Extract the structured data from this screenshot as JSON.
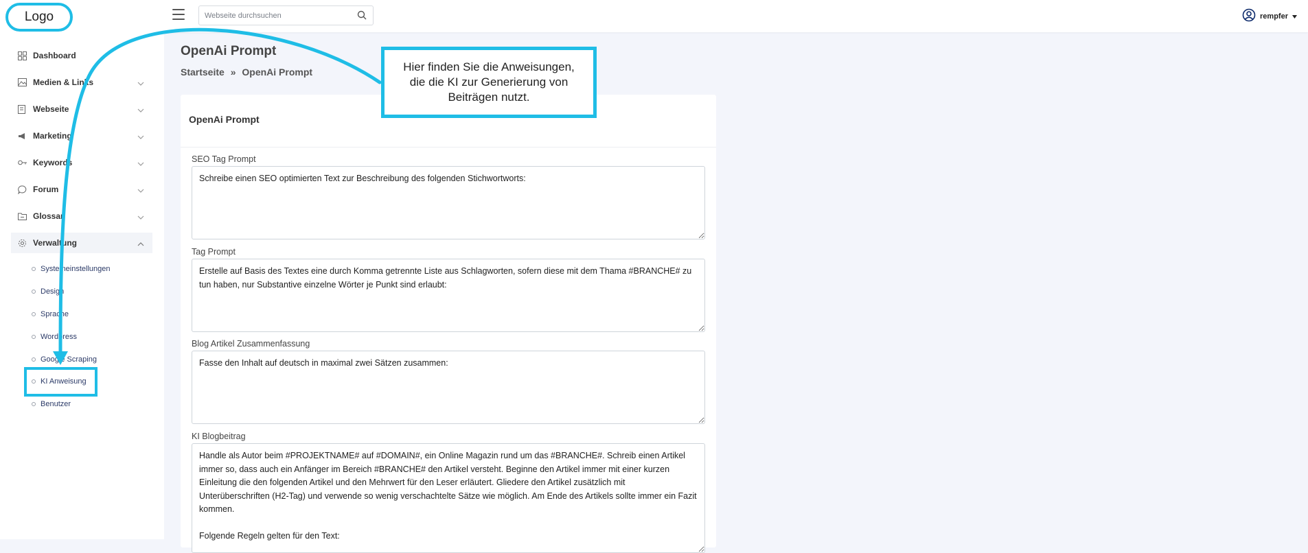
{
  "header": {
    "logo_text": "Logo",
    "search_placeholder": "Webseite durchsuchen",
    "username": "rempfer"
  },
  "sidebar": {
    "items": [
      {
        "label": "Dashboard",
        "icon": "grid-icon"
      },
      {
        "label": "Medien & Links",
        "icon": "image-icon"
      },
      {
        "label": "Webseite",
        "icon": "file-icon"
      },
      {
        "label": "Marketing",
        "icon": "megaphone-icon"
      },
      {
        "label": "Keywords",
        "icon": "key-icon"
      },
      {
        "label": "Forum",
        "icon": "chat-icon"
      },
      {
        "label": "Glossar",
        "icon": "folder-icon"
      },
      {
        "label": "Verwaltung",
        "icon": "gear-icon"
      }
    ],
    "subitems": [
      "Systemeinstellungen",
      "Design",
      "Sprache",
      "Wordpress",
      "Google Scraping",
      "KI Anweisung",
      "Benutzer"
    ]
  },
  "page": {
    "title": "OpenAi Prompt",
    "breadcrumb_home": "Startseite",
    "breadcrumb_sep": "»",
    "breadcrumb_current": "OpenAi Prompt"
  },
  "card": {
    "title": "OpenAi Prompt",
    "fields": [
      {
        "label": "SEO Tag Prompt",
        "value": "Schreibe einen SEO optimierten Text zur Beschreibung des folgenden Stichwortworts:"
      },
      {
        "label": "Tag Prompt",
        "value": "Erstelle auf Basis des Textes eine durch Komma getrennte Liste aus Schlagworten, sofern diese mit dem Thama #BRANCHE# zu tun haben, nur Substantive einzelne Wörter je Punkt sind erlaubt:"
      },
      {
        "label": "Blog Artikel Zusammenfassung",
        "value": "Fasse den Inhalt auf deutsch in maximal zwei Sätzen zusammen:"
      },
      {
        "label": "KI Blogbeitrag",
        "value": "Handle als Autor beim #PROJEKTNAME# auf #DOMAIN#, ein Online Magazin rund um das #BRANCHE#. Schreib einen Artikel immer so, dass auch ein Anfänger im Bereich #BRANCHE# den Artikel versteht. Beginne den Artikel immer mit einer kurzen Einleitung die den folgenden Artikel und den Mehrwert für den Leser erläutert. Gliedere den Artikel zusätzlich mit Unterüberschriften (H2-Tag) und verwende so wenig verschachtelte Sätze wie möglich. Am Ende des Artikels sollte immer ein Fazit kommen.\n\nFolgende Regeln gelten für den Text:"
      }
    ]
  },
  "callout": {
    "text": "Hier finden Sie die Anweisungen, die die KI zur Generierung von Beiträgen nutzt."
  },
  "colors": {
    "highlight": "#1fbde6",
    "background": "#f3f5fb"
  }
}
